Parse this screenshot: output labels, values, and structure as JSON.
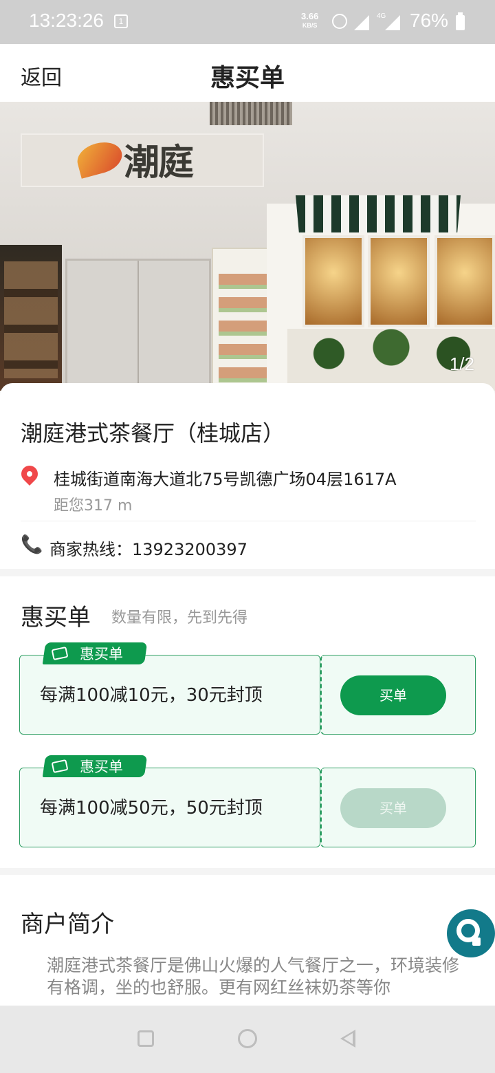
{
  "status_bar": {
    "time": "13:23:26",
    "sim_label": "1",
    "net_speed_value": "3.66",
    "net_speed_unit": "KB/S",
    "network_label": "4G",
    "battery": "76%"
  },
  "navbar": {
    "back_label": "返回",
    "title": "惠买单"
  },
  "hero": {
    "logo_text": "潮庭",
    "counter": "1/2"
  },
  "store": {
    "name": "潮庭港式茶餐厅（桂城店）",
    "address": "桂城街道南海大道北75号凯德广场04层1617A",
    "distance": "距您317 m",
    "hotline_label": "商家热线：13923200397"
  },
  "deals": {
    "heading": "惠买单",
    "subtitle": "数量有限，先到先得",
    "items": [
      {
        "tag": "惠买单",
        "description": "每满100减10元，30元封顶",
        "button": "买单",
        "enabled": true
      },
      {
        "tag": "惠买单",
        "description": "每满100减50元，50元封顶",
        "button": "买单",
        "enabled": false
      }
    ]
  },
  "intro": {
    "heading": "商户简介",
    "text": "潮庭港式茶餐厅是佛山火爆的人气餐厅之一，环境装修有格调，坐的也舒服。更有网红丝袜奶茶等你"
  },
  "colors": {
    "accent_green": "#0e9a4e",
    "disabled_green": "#b8d8c8",
    "pin_red": "#f0484a",
    "phone_orange": "#f5a623"
  },
  "icons": [
    "sim-icon",
    "alarm-icon",
    "signal-icon",
    "battery-icon",
    "location-pin-icon",
    "phone-icon",
    "ticket-icon",
    "customer-service-icon",
    "recent-apps-icon",
    "home-icon",
    "back-icon"
  ]
}
